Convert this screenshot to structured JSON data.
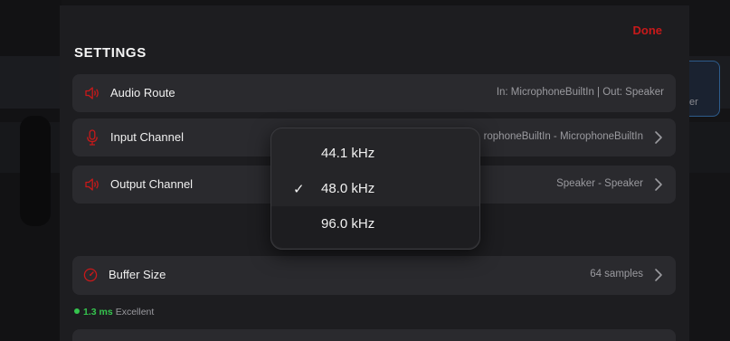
{
  "settings": {
    "done_label": "Done",
    "title": "SETTINGS",
    "rows": [
      {
        "label": "Audio Route",
        "value": "In: MicrophoneBuiltIn | Out: Speaker",
        "icon": "speaker-icon"
      },
      {
        "label": "Input Channel",
        "value": "rophoneBuiltIn - MicrophoneBuiltIn",
        "icon": "microphone-icon"
      },
      {
        "label": "Output Channel",
        "value": "Speaker - Speaker",
        "icon": "speaker-icon"
      },
      {
        "label": "Buffer Size",
        "value": "64 samples",
        "icon": "gauge-icon"
      }
    ],
    "latency": {
      "ms": "1.3 ms",
      "quality": "Excellent"
    }
  },
  "sample_rate_menu": {
    "options": [
      "44.1 kHz",
      "48.0 kHz",
      "96.0 kHz"
    ],
    "selected": "48.0 kHz",
    "check_glyph": "✓"
  },
  "background": {
    "partial_text": "er"
  },
  "colors": {
    "accent": "#c8191a",
    "status_good": "#35c54e",
    "panel": "#1d1d20",
    "row": "#2a2a2e"
  }
}
